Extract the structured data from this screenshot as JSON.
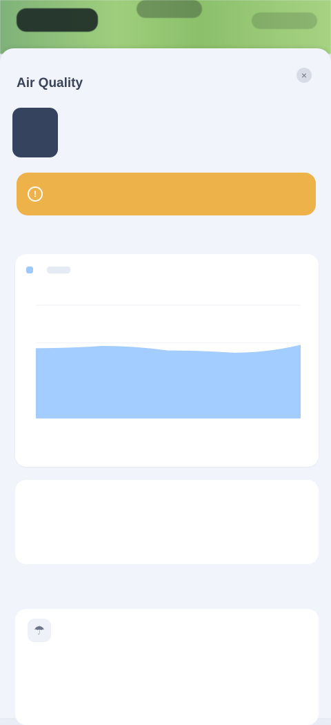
{
  "header": {
    "title": "Air Quality",
    "close_glyph": "×"
  },
  "days": [
    {
      "label": ""
    },
    {
      "label": ""
    },
    {
      "label": ""
    },
    {
      "label": ""
    },
    {
      "label": ""
    },
    {
      "label": ""
    },
    {
      "label": ""
    }
  ],
  "banner": {
    "icon_glyph": "!",
    "text": ""
  },
  "section_title": "",
  "chart_data": {
    "type": "area",
    "title": "",
    "xlabel": "",
    "ylabel": "",
    "legend": {
      "placement": "top-left"
    },
    "x": [
      "",
      "",
      "",
      "",
      ""
    ],
    "series": [
      {
        "values": [
          62,
          64,
          60,
          58,
          65
        ]
      }
    ],
    "ylim": [
      0,
      100
    ]
  },
  "chart_legend_label": "",
  "text_card": {
    "heading": "",
    "body": ""
  },
  "recommendations": {
    "title": "",
    "items": [
      {
        "icon_glyph": "☂",
        "line1": "",
        "line2": ""
      }
    ]
  },
  "colors": {
    "banner": "#eeb24b",
    "active_day": "#35435e",
    "area_fill": "#9ec9ff"
  }
}
